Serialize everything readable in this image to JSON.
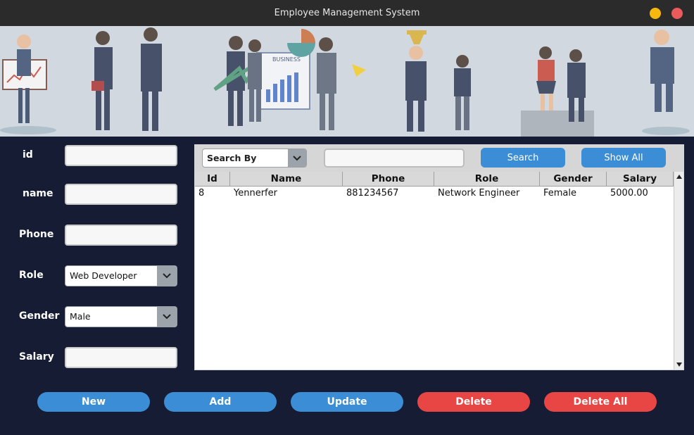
{
  "window": {
    "title": "Employee Management System"
  },
  "form": {
    "id_label": "id",
    "name_label": "name",
    "phone_label": "Phone",
    "role_label": "Role",
    "gender_label": "Gender",
    "salary_label": "Salary",
    "id_value": "",
    "name_value": "",
    "phone_value": "",
    "role_value": "Web Developer",
    "gender_value": "Male",
    "salary_value": ""
  },
  "search": {
    "search_by": "Search By",
    "query": "",
    "search_label": "Search",
    "show_all_label": "Show All"
  },
  "table": {
    "columns": [
      "Id",
      "Name",
      "Phone",
      "Role",
      "Gender",
      "Salary"
    ],
    "rows": [
      [
        "8",
        "Yennerfer",
        "881234567",
        "Network Engineer",
        "Female",
        "5000.00"
      ]
    ]
  },
  "actions": {
    "new_label": "New",
    "add_label": "Add",
    "update_label": "Update",
    "delete_label": "Delete",
    "delete_all_label": "Delete All"
  },
  "banner": {
    "sign_text": "BUSINESS"
  },
  "colors": {
    "primary": "#3b8ed6",
    "danger": "#e84545",
    "background": "#161c33"
  }
}
